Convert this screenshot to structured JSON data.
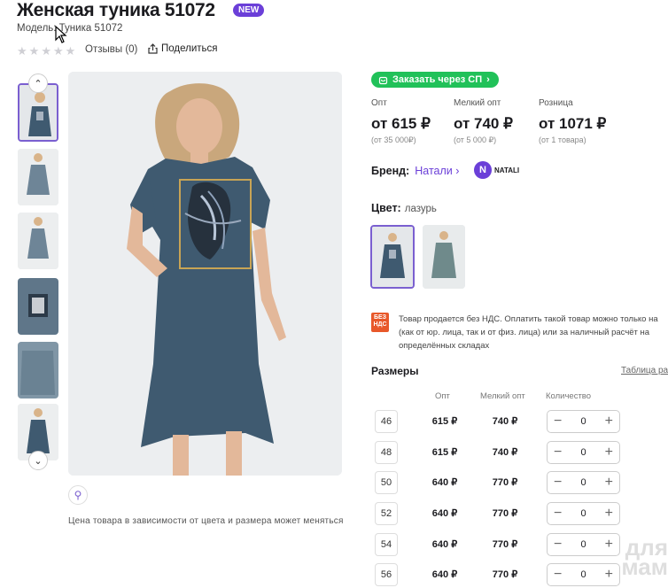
{
  "product": {
    "title": "Женская туника 51072",
    "badge": "NEW",
    "model_label": "Модель: Туника 51072",
    "reviews": "Отзывы (0)",
    "share": "Поделиться"
  },
  "gallery": {
    "note": "Цена товара в зависимости от цвета и размера может меняться"
  },
  "order": {
    "sp_button": "Заказать через СП"
  },
  "prices": [
    {
      "label": "Опт",
      "value": "от 615 ₽",
      "sub": "(от 35 000₽)"
    },
    {
      "label": "Мелкий опт",
      "value": "от 740 ₽",
      "sub": "(от 5 000 ₽)"
    },
    {
      "label": "Розница",
      "value": "от 1071 ₽",
      "sub": "(от 1 товара)"
    }
  ],
  "brand": {
    "label": "Бренд:",
    "name": "Натали",
    "logo_letter": "N",
    "logo_text": "NATALI"
  },
  "color": {
    "label": "Цвет:",
    "value": "лазурь"
  },
  "nds": {
    "icon_text": "БЕЗ НДС",
    "text": "Товар продается без НДС. Оплатить такой товар можно только на (как от юр. лица, так и от физ. лица) или за наличный расчёт на определённых складах"
  },
  "sizes": {
    "title": "Размеры",
    "table_link": "Таблица ра",
    "headers": {
      "opt": "Опт",
      "small_opt": "Мелкий опт",
      "qty": "Количество"
    },
    "rows": [
      {
        "size": "46",
        "opt": "615 ₽",
        "small": "740 ₽",
        "qty": "0"
      },
      {
        "size": "48",
        "opt": "615 ₽",
        "small": "740 ₽",
        "qty": "0"
      },
      {
        "size": "50",
        "opt": "640 ₽",
        "small": "770 ₽",
        "qty": "0"
      },
      {
        "size": "52",
        "opt": "640 ₽",
        "small": "770 ₽",
        "qty": "0"
      },
      {
        "size": "54",
        "opt": "640 ₽",
        "small": "770 ₽",
        "qty": "0"
      },
      {
        "size": "56",
        "opt": "640 ₽",
        "small": "770 ₽",
        "qty": "0"
      }
    ]
  },
  "watermark": "для мам",
  "colors": {
    "accent": "#6b3fd8",
    "green": "#21c159",
    "nds": "#e8582a",
    "dress": "#3f5a70"
  }
}
